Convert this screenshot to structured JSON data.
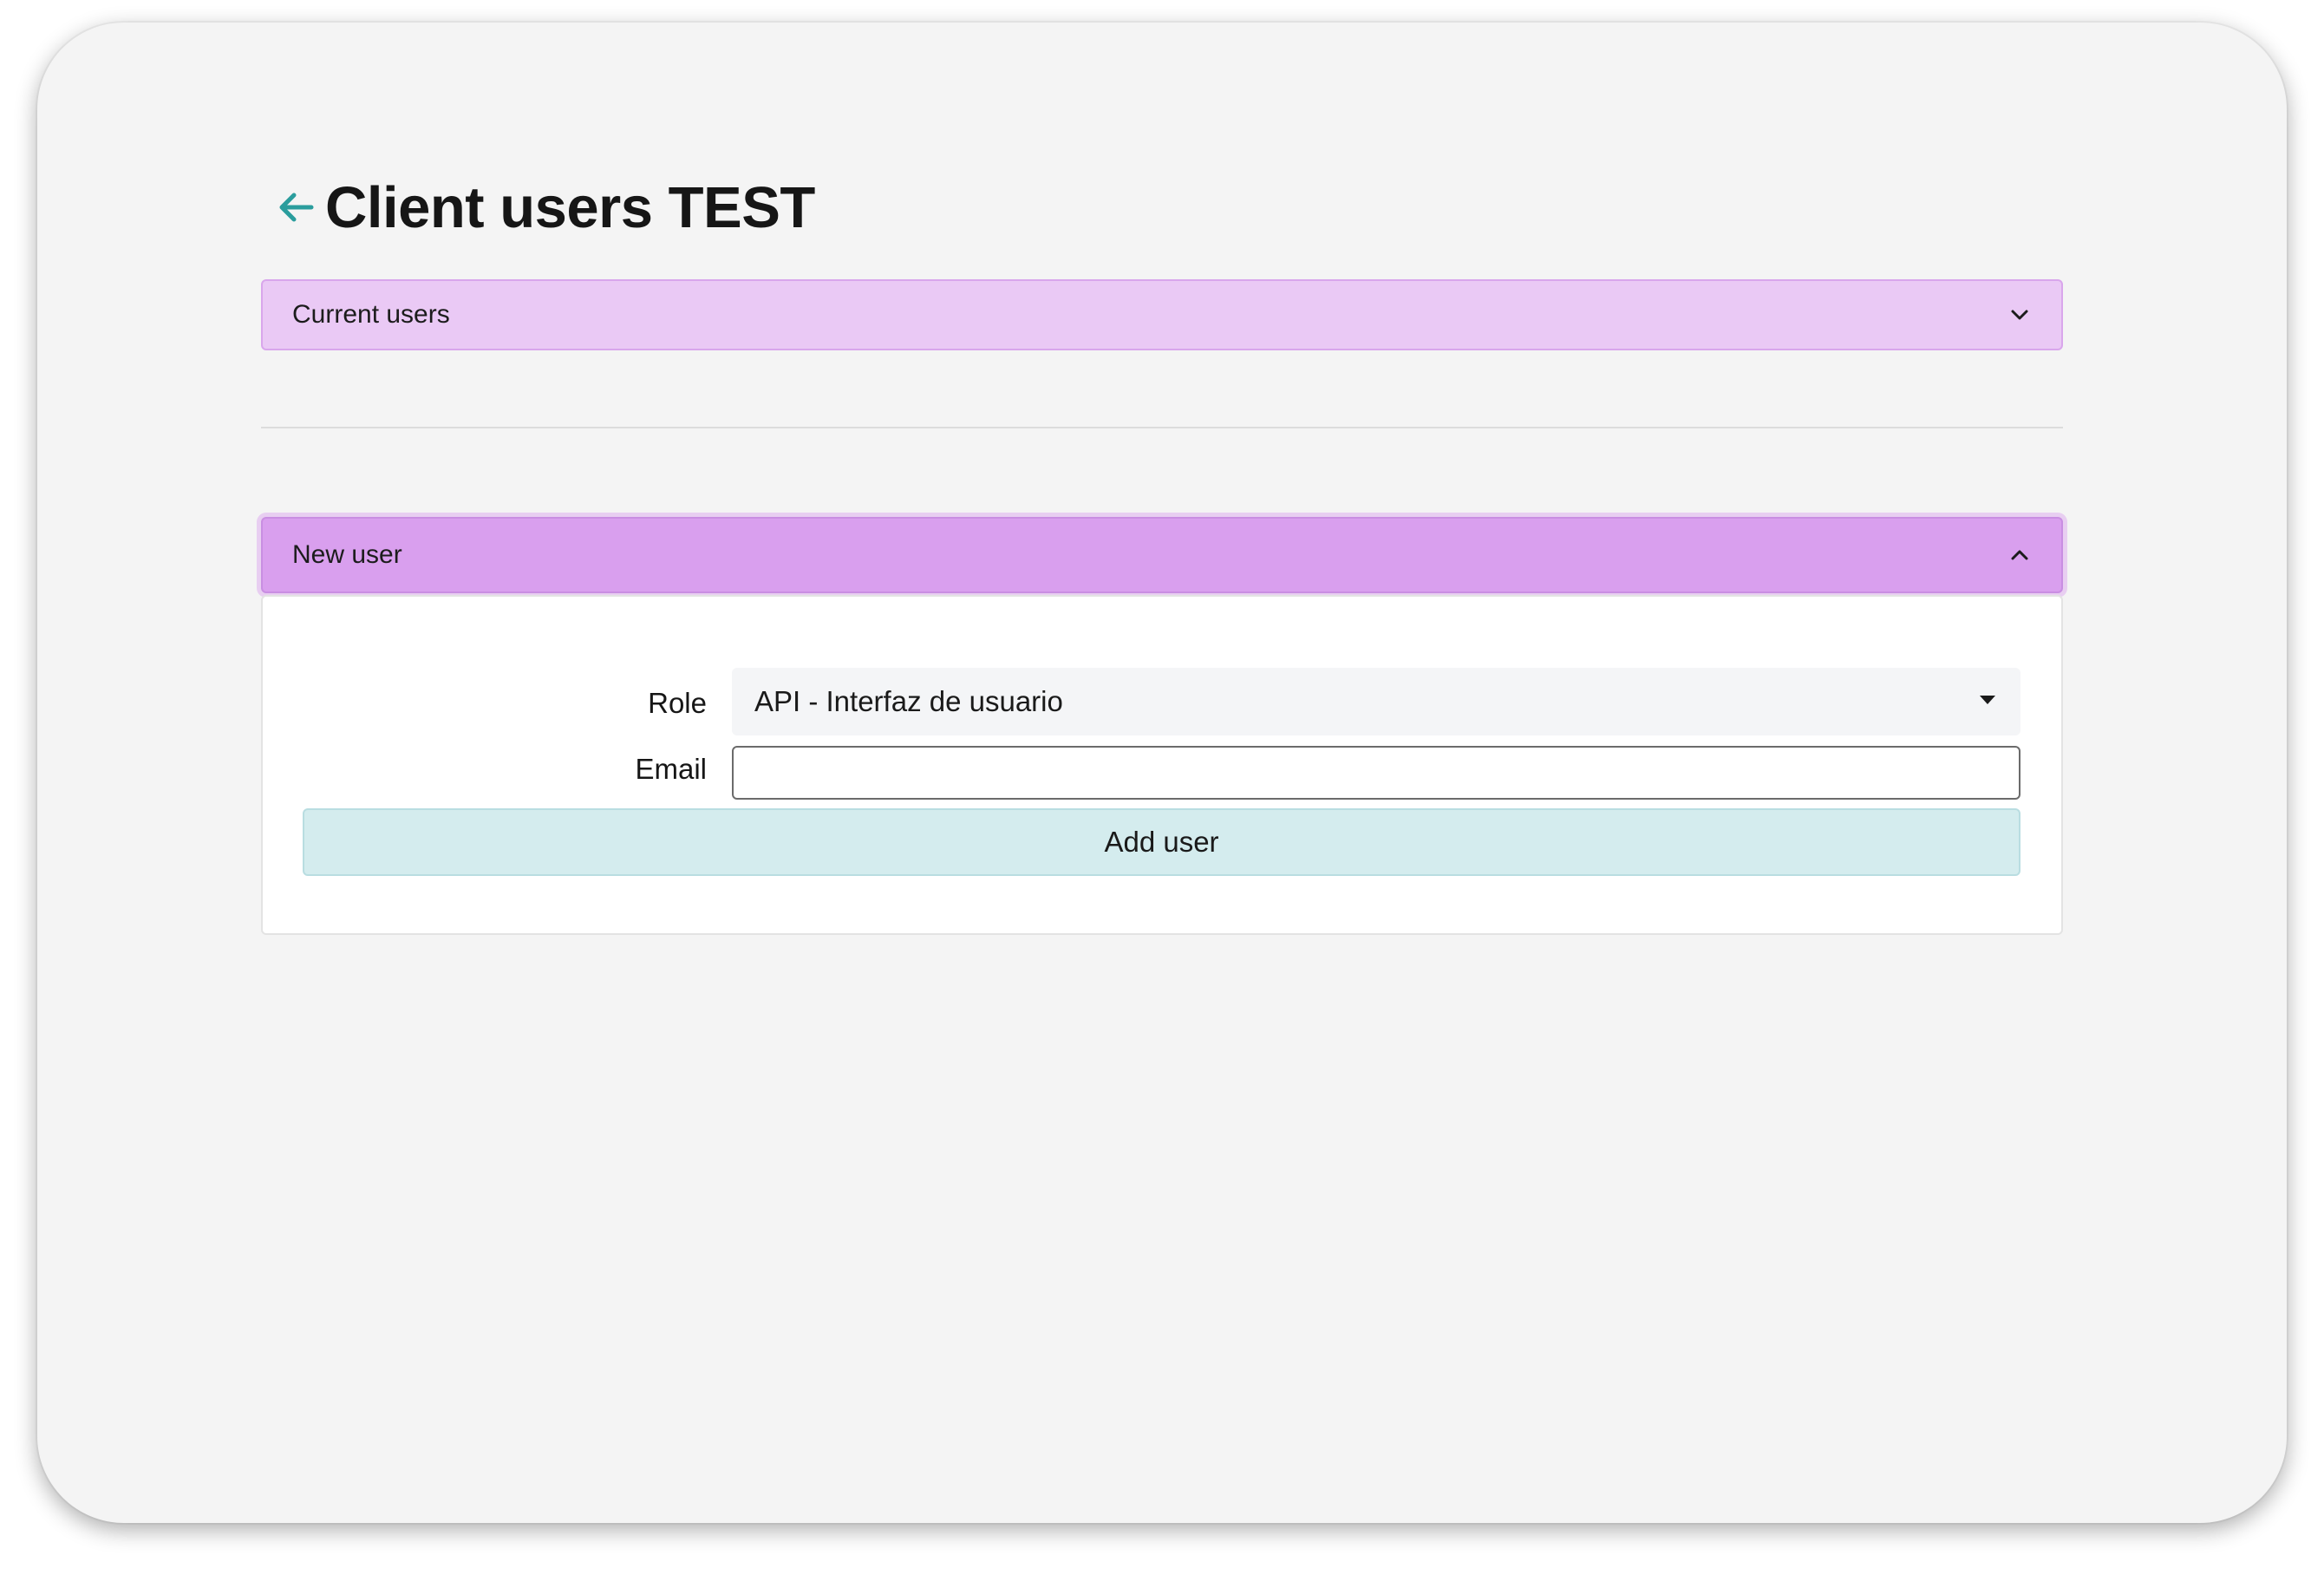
{
  "page": {
    "title": "Client users TEST",
    "back_icon": "arrow-left-icon"
  },
  "sections": {
    "current_users": {
      "label": "Current users",
      "state": "collapsed",
      "icon": "chevron-down-icon"
    },
    "new_user": {
      "label": "New user",
      "state": "expanded",
      "icon": "chevron-up-icon"
    }
  },
  "form": {
    "role_label": "Role",
    "role_value": "API - Interfaz de usuario",
    "email_label": "Email",
    "email_value": "",
    "submit_label": "Add user"
  },
  "colors": {
    "accent_teal": "#2a9d9d",
    "accordion_collapsed": "#eac9f5",
    "accordion_expanded": "#d99fee",
    "button_bg": "#d4ecee"
  }
}
